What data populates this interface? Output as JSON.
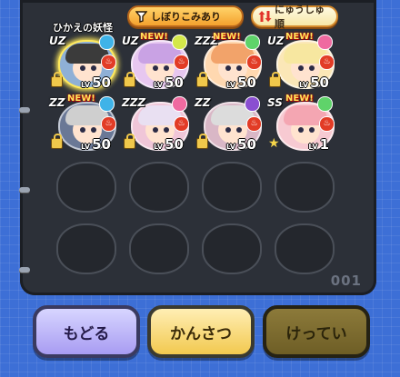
{
  "header": {
    "label": "ひかえの妖怪",
    "filter_label": "しぼりこみあり",
    "sort_label": "にゅうしゅ順"
  },
  "rows": [
    [
      {
        "rank": "UZ",
        "new": false,
        "level": "50",
        "icon": "lock",
        "hair": "#3b3b3b",
        "bg": "#8fb0d6",
        "tribe": "#3fb3e8",
        "selected": true
      },
      {
        "rank": "UZ",
        "new": true,
        "level": "50",
        "icon": "lock",
        "hair": "#c9a2e4",
        "bg": "#e7c7f0",
        "tribe": "#d4e84a"
      },
      {
        "rank": "ZZZ",
        "new": true,
        "level": "50",
        "icon": "lock",
        "hair": "#f2a36a",
        "bg": "#ffd8b0",
        "tribe": "#5fd36a"
      },
      {
        "rank": "UZ",
        "new": true,
        "level": "50",
        "icon": "lock",
        "hair": "#f7e7a0",
        "bg": "#fbe7b7",
        "tribe": "#ef6aa0"
      }
    ],
    [
      {
        "rank": "ZZ",
        "new": true,
        "level": "50",
        "icon": "lock",
        "hair": "#cfcfcf",
        "bg": "#6a7896",
        "tribe": "#3fb3e8"
      },
      {
        "rank": "ZZZ",
        "new": false,
        "level": "50",
        "icon": "lock",
        "hair": "#e9e0f2",
        "bg": "#f0c6d8",
        "tribe": "#ef6aa0"
      },
      {
        "rank": "ZZ",
        "new": false,
        "level": "50",
        "icon": "lock",
        "hair": "#dcdcdc",
        "bg": "#d9b7c6",
        "tribe": "#8a4fd1"
      },
      {
        "rank": "SS",
        "new": true,
        "level": "1",
        "icon": "star",
        "hair": "#f4a6b2",
        "bg": "#f7cad2",
        "tribe": "#5fd36a"
      }
    ]
  ],
  "page_number": "001",
  "buttons": {
    "back": "もどる",
    "inspect": "かんさつ",
    "confirm": "けってい"
  },
  "level_prefix": "LV"
}
